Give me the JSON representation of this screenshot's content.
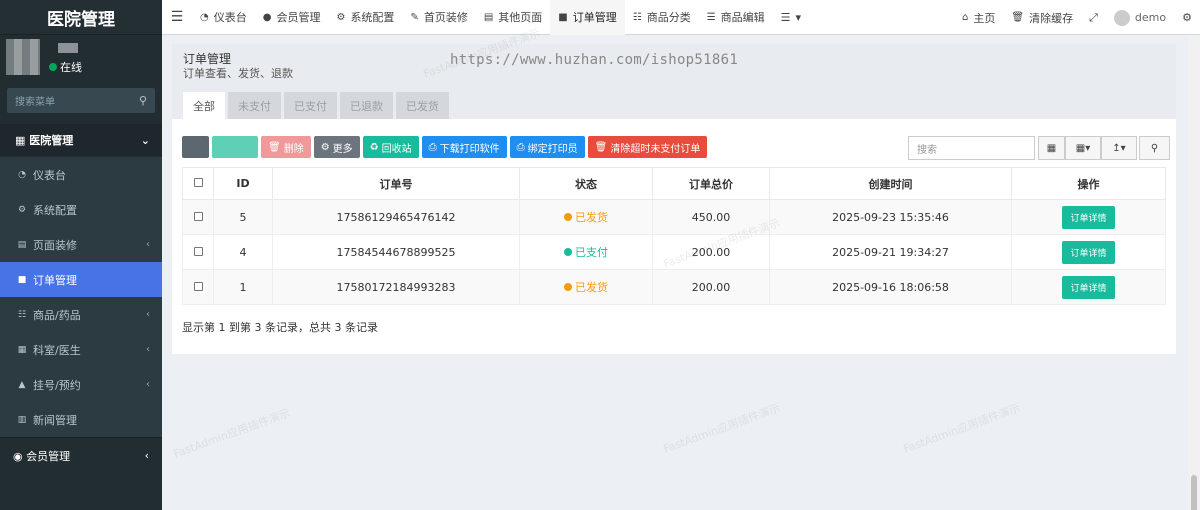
{
  "sidebar": {
    "logo": "医院管理",
    "status": "在线",
    "search_placeholder": "搜索菜单",
    "group": "医院管理",
    "items": [
      {
        "label": "仪表台",
        "icon": "dashboard-icon",
        "chev": ""
      },
      {
        "label": "系统配置",
        "icon": "gear-icon",
        "chev": ""
      },
      {
        "label": "页面装修",
        "icon": "page-icon",
        "chev": "‹"
      },
      {
        "label": "订单管理",
        "icon": "file-icon",
        "chev": ""
      },
      {
        "label": "商品/药品",
        "icon": "grid-icon",
        "chev": "‹"
      },
      {
        "label": "科室/医生",
        "icon": "calendar-icon",
        "chev": "‹"
      },
      {
        "label": "挂号/预约",
        "icon": "bell-icon",
        "chev": "‹"
      },
      {
        "label": "新闻管理",
        "icon": "news-icon",
        "chev": ""
      }
    ],
    "bottom": "会员管理"
  },
  "topnav": {
    "tabs": [
      {
        "label": "仪表台",
        "icon": "dashboard-icon"
      },
      {
        "label": "会员管理",
        "icon": "user-icon"
      },
      {
        "label": "系统配置",
        "icon": "gear-icon"
      },
      {
        "label": "首页装修",
        "icon": "edit-icon"
      },
      {
        "label": "其他页面",
        "icon": "page-icon"
      },
      {
        "label": "订单管理",
        "icon": "file-icon"
      },
      {
        "label": "商品分类",
        "icon": "grid-icon"
      },
      {
        "label": "商品编辑",
        "icon": "list-icon"
      }
    ],
    "home": "主页",
    "clear_cache": "清除缓存",
    "user": "demo"
  },
  "header": {
    "title": "订单管理",
    "subtitle": "订单查看、发货、退款",
    "tabs": [
      "全部",
      "未支付",
      "已支付",
      "已退款",
      "已发货"
    ]
  },
  "toolbar": {
    "delete": "删除",
    "more": "更多",
    "recycle": "回收站",
    "download": "下载打印软件",
    "bind_printer": "绑定打印员",
    "clear_unpaid": "清除超时未支付订单",
    "search_placeholder": "搜索"
  },
  "table": {
    "columns": [
      "ID",
      "订单号",
      "状态",
      "订单总价",
      "创建时间",
      "操作"
    ],
    "rows": [
      {
        "id": "5",
        "order_no": "17586129465476142",
        "status": "已发货",
        "status_color": "#f39c12",
        "total": "450.00",
        "created": "2025-09-23 15:35:46",
        "action": "订单详情"
      },
      {
        "id": "4",
        "order_no": "17584544678899525",
        "status": "已支付",
        "status_color": "#18bc9c",
        "total": "200.00",
        "created": "2025-09-21 19:34:27",
        "action": "订单详情"
      },
      {
        "id": "1",
        "order_no": "17580172184993283",
        "status": "已发货",
        "status_color": "#f39c12",
        "total": "200.00",
        "created": "2025-09-16 18:06:58",
        "action": "订单详情"
      }
    ]
  },
  "pager_info": "显示第 1 到第 3 条记录，总共 3 条记录",
  "watermark_url": "https://www.huzhan.com/ishop51861",
  "watermark_text": "FastAdmin应用插件演示"
}
